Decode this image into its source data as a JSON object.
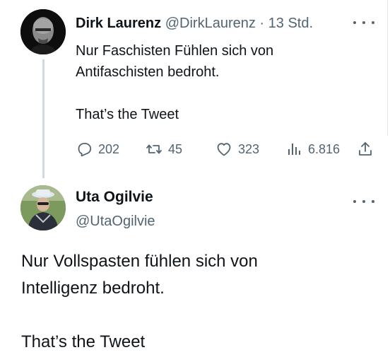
{
  "parent_tweet": {
    "author_name": "Dirk Laurenz",
    "handle": "@DirkLaurenz",
    "separator": "·",
    "time": "13 Std.",
    "text_lines": [
      "Nur Faschisten Fühlen sich von",
      "Antifaschisten bedroht."
    ],
    "text_tail": "That’s the Tweet",
    "stats": {
      "replies": "202",
      "retweets": "45",
      "likes": "323",
      "views": "6.816"
    }
  },
  "reply_tweet": {
    "author_name": "Uta Ogilvie",
    "handle": "@UtaOgilvie",
    "text_lines": [
      "Nur Vollspasten fühlen sich von",
      "Intelligenz bedroht."
    ],
    "text_tail": "That’s the Tweet"
  },
  "icons": {
    "more": "more-horizontal-icon",
    "reply": "reply-icon",
    "retweet": "retweet-icon",
    "like": "heart-icon",
    "views": "views-chart-icon",
    "share": "share-icon"
  },
  "colors": {
    "text": "#0f1419",
    "muted": "#536471",
    "thread_line": "#cfd9de"
  }
}
